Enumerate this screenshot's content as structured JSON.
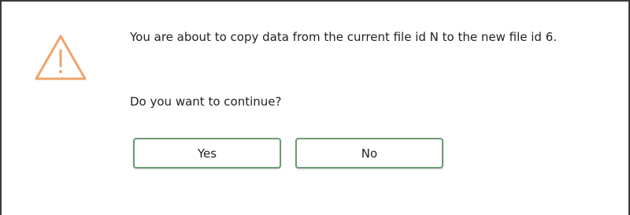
{
  "dialog": {
    "icon": "warning-triangle-icon",
    "message": "You are about to copy data from the current file id N to the new file id 6.",
    "question": "Do you want to continue?",
    "buttons": {
      "yes_label": "Yes",
      "no_label": "No"
    }
  },
  "colors": {
    "warning_orange": "#f0a46a",
    "button_border_green": "#6f9a72"
  }
}
